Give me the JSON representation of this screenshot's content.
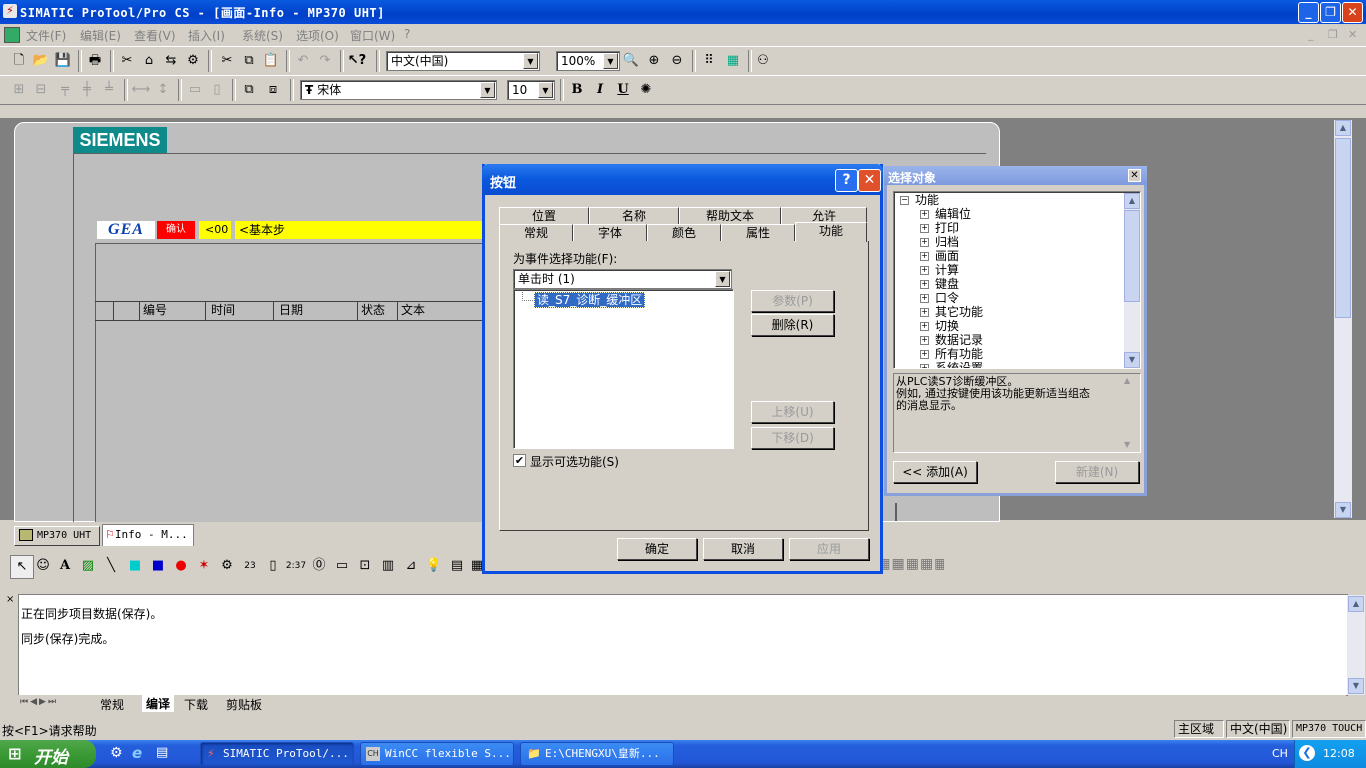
{
  "window": {
    "title": "SIMATIC ProTool/Pro CS - [画面-Info - MP370 UHT]"
  },
  "menu": [
    "文件(F)",
    "编辑(E)",
    "查看(V)",
    "插入(I)",
    "系统(S)",
    "选项(O)",
    "窗口(W)",
    "?"
  ],
  "toolbar1": {
    "language": "中文(中国)",
    "zoom": "100%"
  },
  "toolbar2": {
    "font": "宋体",
    "font_size": "10",
    "bold": "B",
    "italic": "I",
    "underline": "U"
  },
  "screen": {
    "logo": "SIEMENS",
    "gea": "GEA",
    "red_label": "确认",
    "yellow_small": "<00",
    "yellow_label": "<基本步",
    "columns": [
      "编号",
      "时间",
      "日期",
      "状态",
      "文本"
    ]
  },
  "doc_tabs": [
    {
      "label": "MP370 UHT"
    },
    {
      "label": "Info - M..."
    }
  ],
  "button_dialog": {
    "title": "按钮",
    "tabs_row1": [
      "位置",
      "名称",
      "帮助文本",
      "允许"
    ],
    "tabs_row2": [
      "常规",
      "字体",
      "颜色",
      "属性",
      "功能"
    ],
    "event_label": "为事件选择功能(F):",
    "event_value": "单击时   (1)",
    "function_item": "读_S7_诊断_缓冲区",
    "params_button": "参数(P)",
    "delete_button": "删除(R)",
    "up_button": "上移(U)",
    "down_button": "下移(D)",
    "show_optional_label": "显示可选功能(S)",
    "show_optional_checked": true,
    "ok": "确定",
    "cancel": "取消",
    "apply": "应用"
  },
  "select_object": {
    "title": "选择对象",
    "root": "功能",
    "items": [
      "编辑位",
      "打印",
      "归档",
      "画面",
      "计算",
      "键盘",
      "口令",
      "其它功能",
      "切换",
      "数据记录",
      "所有功能",
      "系统设置"
    ],
    "description_line1": "从PLC读S7诊断缓冲区。",
    "description_line2": "例如, 通过按键使用该功能更新适当组态",
    "description_line3": "的消息显示。",
    "add_button": "<< 添加(A)",
    "new_button": "新建(N)"
  },
  "output": {
    "lines": [
      "正在同步项目数据(保存)。",
      "同步(保存)完成。"
    ],
    "tabs": [
      "常规",
      "编译",
      "下载",
      "剪贴板"
    ]
  },
  "status": {
    "help": "按<F1>请求帮助",
    "area": "主区域",
    "language": "中文(中国)",
    "device": "MP370 TOUCH"
  },
  "taskbar": {
    "start": "开始",
    "tasks": [
      "SIMATIC ProTool/...",
      "WinCC flexible S...",
      "E:\\CHENGXU\\皇新..."
    ],
    "lang": "CH",
    "time": "12:08"
  },
  "colors": {
    "titlebar": "#0a4cd8",
    "siemens_teal": "#0e8a8a",
    "yellow": "#ffff00",
    "red": "#ff0000"
  }
}
